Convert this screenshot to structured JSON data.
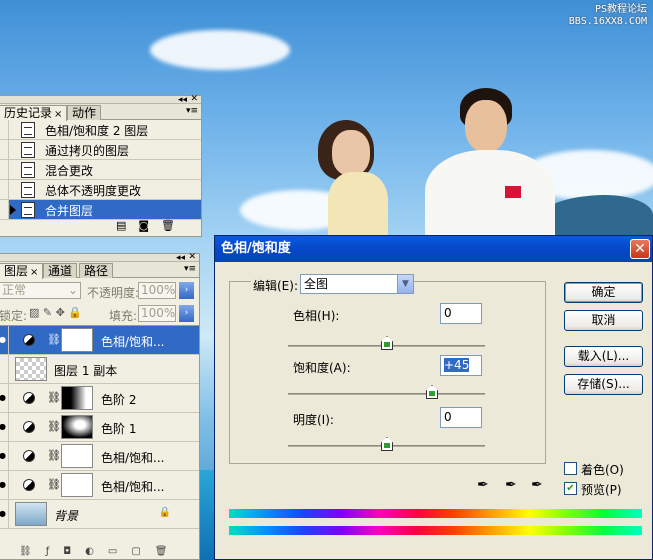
{
  "watermark": {
    "line1": "PS教程论坛",
    "line2": "BBS.16XX8.COM"
  },
  "history_panel": {
    "tabs": [
      {
        "label": "历史记录",
        "close": "×"
      },
      {
        "label": "动作"
      }
    ],
    "items": [
      {
        "label": "色相/饱和度 2 图层"
      },
      {
        "label": "通过拷贝的图层"
      },
      {
        "label": "混合更改"
      },
      {
        "label": "总体不透明度更改"
      },
      {
        "label": "合并图层"
      }
    ]
  },
  "layers_panel": {
    "tabs": [
      {
        "label": "图层",
        "close": "×"
      },
      {
        "label": "通道"
      },
      {
        "label": "路径"
      }
    ],
    "blend_mode": "正常",
    "opacity_label": "不透明度:",
    "opacity_value": "100%",
    "lock_label": "锁定:",
    "fill_label": "填充:",
    "fill_value": "100%",
    "layers": [
      {
        "name": "色相/饱和..."
      },
      {
        "name": "图层 1 副本"
      },
      {
        "name": "色阶 2"
      },
      {
        "name": "色阶 1"
      },
      {
        "name": "色相/饱和..."
      },
      {
        "name": "色相/饱和..."
      },
      {
        "name": "背景"
      }
    ]
  },
  "dialog": {
    "title": "色相/饱和度",
    "close": "✕",
    "edit_label": "编辑(E):",
    "edit_value": "全图",
    "hue_label": "色相(H):",
    "hue_value": "0",
    "saturation_label": "饱和度(A):",
    "saturation_value": "+45",
    "lightness_label": "明度(I):",
    "lightness_value": "0",
    "ok": "确定",
    "cancel": "取消",
    "load": "载入(L)...",
    "save": "存储(S)...",
    "colorize_label": "着色(O)",
    "colorize_checked": false,
    "preview_label": "预览(P)",
    "preview_checked": true
  }
}
